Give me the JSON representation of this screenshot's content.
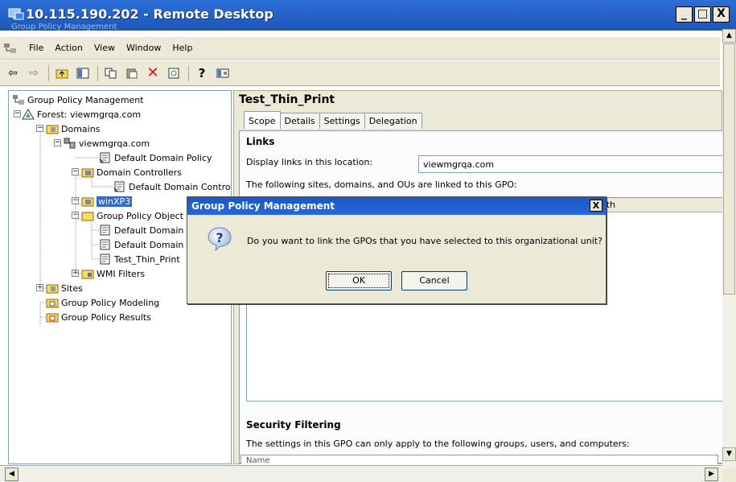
{
  "remote_desktop": {
    "title": "10.115.190.202 - Remote Desktop",
    "inner_caption": "Group Policy Management",
    "buttons": [
      "_",
      "□",
      "X"
    ]
  },
  "menubar": {
    "items": [
      "File",
      "Action",
      "View",
      "Window",
      "Help"
    ]
  },
  "toolbar": {
    "icons": [
      "back-arrow-icon",
      "forward-arrow-icon",
      "up-folder-icon",
      "show-hide-tree-icon",
      "copy-icon",
      "paste-icon",
      "delete-icon",
      "refresh-icon",
      "help-icon",
      "console-icon"
    ]
  },
  "tree": {
    "root": "Group Policy Management",
    "forest": "Forest: viewmgrqa.com",
    "domains": "Domains",
    "domain": "viewmgrqa.com",
    "default_domain_policy": "Default Domain Policy",
    "domain_controllers": "Domain Controllers",
    "default_domain_controllers": "Default Domain Controlle",
    "winxp3": "winXP3",
    "gpo_objects": "Group Policy Object",
    "gpo_item1": "Default Domain",
    "gpo_item2": "Default Domain",
    "gpo_item3": "Test_Thin_Print",
    "wmi_filters": "WMI Filters",
    "sites": "Sites",
    "modeling": "Group Policy Modeling",
    "results": "Group Policy Results"
  },
  "details": {
    "gpo_name": "Test_Thin_Print",
    "tabs": [
      "Scope",
      "Details",
      "Settings",
      "Delegation"
    ],
    "active_tab": "Scope",
    "links_heading": "Links",
    "display_links_label": "Display links in this location:",
    "display_links_value": "viewmgrqa.com",
    "linked_text": "The following sites, domains, and OUs are linked to this GPO:",
    "path_column": "ath",
    "security_heading": "Security Filtering",
    "security_text": "The settings in this GPO can only apply to the following groups, users, and computers:",
    "name_column": "Name"
  },
  "dialog": {
    "title": "Group Policy Management",
    "close": "X",
    "message": "Do you want to link the GPOs that you have selected to this organizational unit?",
    "ok_label": "OK",
    "cancel_label": "Cancel"
  },
  "colors": {
    "title_bar": "#1d56b8",
    "selection": "#316ac5",
    "dialog_face": "#ece9d8"
  }
}
